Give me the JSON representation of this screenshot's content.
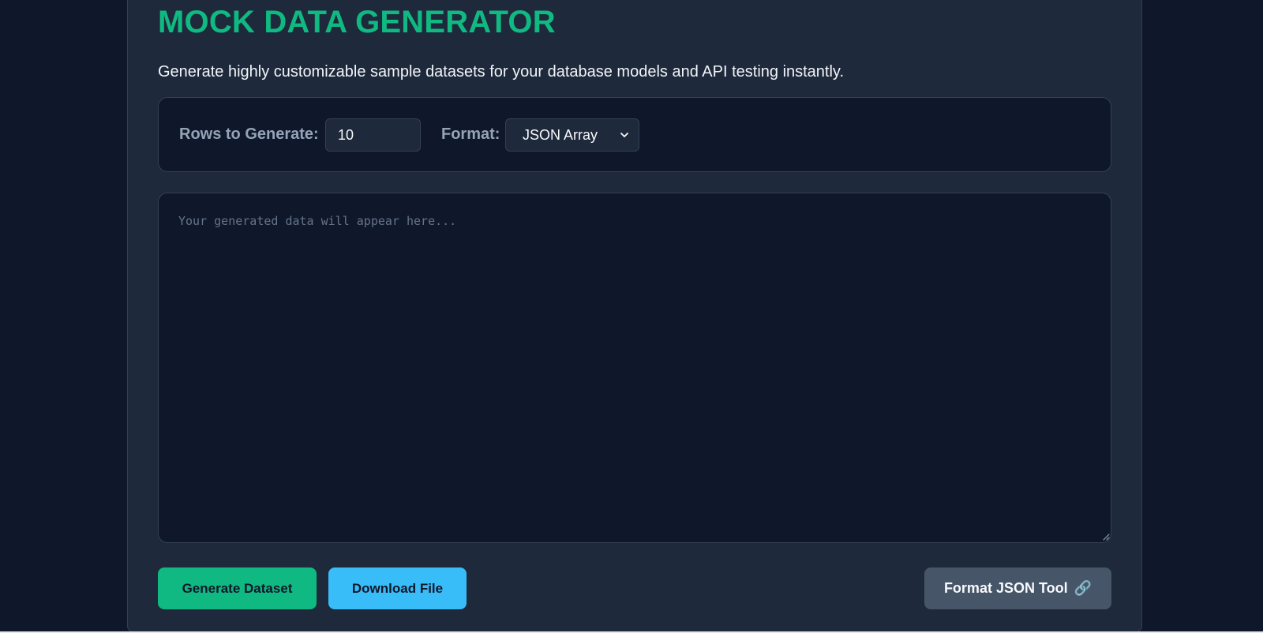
{
  "page": {
    "title": "MOCK DATA GENERATOR",
    "subtitle": "Generate highly customizable sample datasets for your database models and API testing instantly."
  },
  "controls": {
    "rows_label": "Rows to Generate:",
    "rows_value": "10",
    "format_label": "Format:",
    "format_selected": "JSON Array"
  },
  "output": {
    "placeholder": "Your generated data will appear here...",
    "value": ""
  },
  "actions": {
    "generate_label": "Generate Dataset",
    "download_label": "Download File",
    "format_tool_label": "Format JSON Tool",
    "format_tool_icon": "🔗"
  },
  "colors": {
    "background": "#0f172a",
    "card": "#1e293b",
    "accent_green": "#10b981",
    "accent_blue": "#38bdf8",
    "muted_button": "#475569",
    "label_text": "#94a3b8"
  }
}
